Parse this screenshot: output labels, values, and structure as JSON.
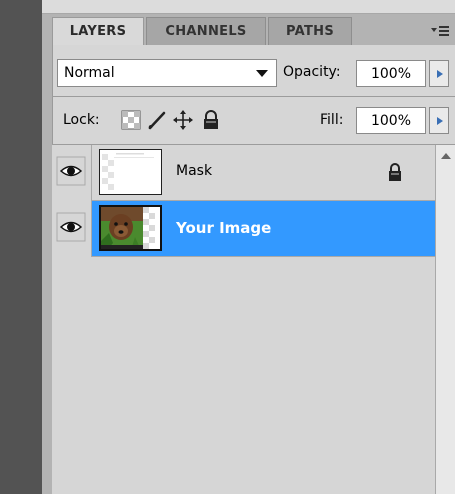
{
  "panel": {
    "tabs": [
      {
        "label": "LAYERS",
        "active": true
      },
      {
        "label": "CHANNELS",
        "active": false
      },
      {
        "label": "PATHS",
        "active": false
      }
    ],
    "menu_icon": "panel-menu-icon"
  },
  "blend_mode": {
    "value": "Normal"
  },
  "opacity": {
    "label": "Opacity:",
    "value": "100%"
  },
  "lock": {
    "label": "Lock:",
    "icons": [
      "lock-transparent-pixels-icon",
      "lock-image-pixels-icon",
      "lock-position-icon",
      "lock-all-icon"
    ]
  },
  "fill": {
    "label": "Fill:",
    "value": "100%"
  },
  "layers": [
    {
      "name": "Mask",
      "visible": true,
      "selected": false,
      "locked": true
    },
    {
      "name": "Your Image",
      "visible": true,
      "selected": true,
      "locked": false
    }
  ],
  "colors": {
    "selection": "#3399ff",
    "panel_bg": "#d6d6d6",
    "dock_bg": "#535353"
  }
}
